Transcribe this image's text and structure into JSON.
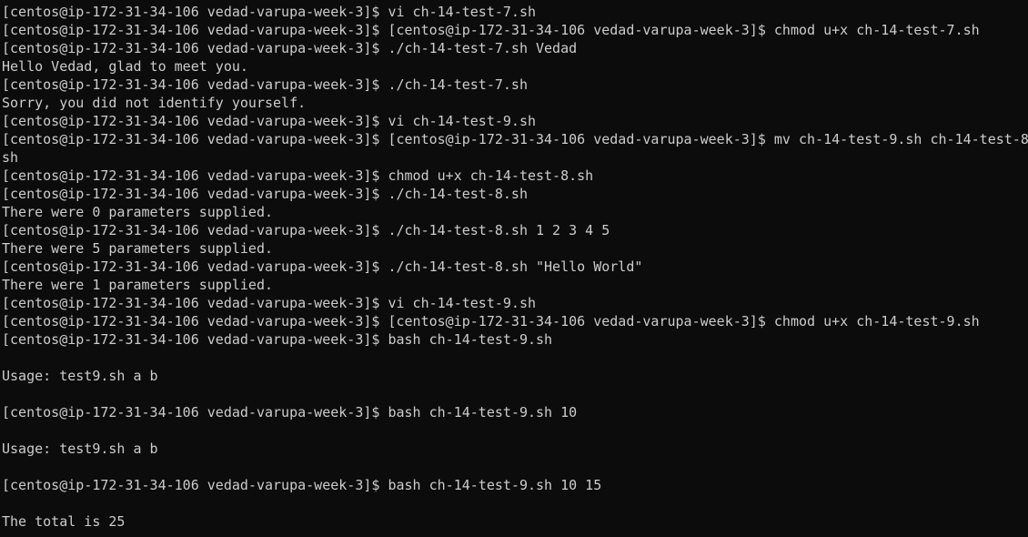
{
  "terminal": {
    "lines": [
      "[centos@ip-172-31-34-106 vedad-varupa-week-3]$ vi ch-14-test-7.sh",
      "[centos@ip-172-31-34-106 vedad-varupa-week-3]$ [centos@ip-172-31-34-106 vedad-varupa-week-3]$ chmod u+x ch-14-test-7.sh",
      "[centos@ip-172-31-34-106 vedad-varupa-week-3]$ ./ch-14-test-7.sh Vedad",
      "Hello Vedad, glad to meet you.",
      "[centos@ip-172-31-34-106 vedad-varupa-week-3]$ ./ch-14-test-7.sh",
      "Sorry, you did not identify yourself.",
      "[centos@ip-172-31-34-106 vedad-varupa-week-3]$ vi ch-14-test-9.sh",
      "[centos@ip-172-31-34-106 vedad-varupa-week-3]$ [centos@ip-172-31-34-106 vedad-varupa-week-3]$ mv ch-14-test-9.sh ch-14-test-8.",
      "sh",
      "[centos@ip-172-31-34-106 vedad-varupa-week-3]$ chmod u+x ch-14-test-8.sh",
      "[centos@ip-172-31-34-106 vedad-varupa-week-3]$ ./ch-14-test-8.sh",
      "There were 0 parameters supplied.",
      "[centos@ip-172-31-34-106 vedad-varupa-week-3]$ ./ch-14-test-8.sh 1 2 3 4 5",
      "There were 5 parameters supplied.",
      "[centos@ip-172-31-34-106 vedad-varupa-week-3]$ ./ch-14-test-8.sh \"Hello World\"",
      "There were 1 parameters supplied.",
      "[centos@ip-172-31-34-106 vedad-varupa-week-3]$ vi ch-14-test-9.sh",
      "[centos@ip-172-31-34-106 vedad-varupa-week-3]$ [centos@ip-172-31-34-106 vedad-varupa-week-3]$ chmod u+x ch-14-test-9.sh",
      "[centos@ip-172-31-34-106 vedad-varupa-week-3]$ bash ch-14-test-9.sh",
      "",
      "Usage: test9.sh a b",
      "",
      "[centos@ip-172-31-34-106 vedad-varupa-week-3]$ bash ch-14-test-9.sh 10",
      "",
      "Usage: test9.sh a b",
      "",
      "[centos@ip-172-31-34-106 vedad-varupa-week-3]$ bash ch-14-test-9.sh 10 15",
      "",
      "The total is 25"
    ]
  },
  "colors": {
    "background": "#0c0c0c",
    "foreground": "#cccccc"
  }
}
